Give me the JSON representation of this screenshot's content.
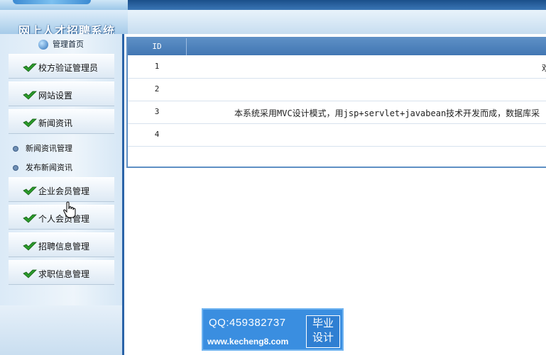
{
  "header": {
    "system_title": "网上人才招聘系统"
  },
  "sidebar": {
    "home_label": "管理首页",
    "menu": [
      {
        "label": "校方验证管理员"
      },
      {
        "label": "网站设置"
      },
      {
        "label": "新闻资讯"
      }
    ],
    "sub_items": [
      {
        "label": "新闻资讯管理"
      },
      {
        "label": "发布新闻资讯"
      }
    ],
    "menu2": [
      {
        "label": "企业会员管理"
      },
      {
        "label": "个人会员管理"
      },
      {
        "label": "招聘信息管理"
      },
      {
        "label": "求职信息管理"
      }
    ]
  },
  "table": {
    "header_id": "ID",
    "rows": [
      {
        "id": "1",
        "content": "欢"
      },
      {
        "id": "2",
        "content": ""
      },
      {
        "id": "3",
        "content": "本系统采用MVC设计模式，用jsp+servlet+javabean技术开发而成，数据库采"
      },
      {
        "id": "4",
        "content": ""
      }
    ]
  },
  "watermark": {
    "qq": "QQ:459382737",
    "url": "www.kecheng8.com",
    "badge_line1": "毕业",
    "badge_line2": "设计"
  },
  "colors": {
    "accent": "#2a63a8",
    "table_header": "#4f83bd",
    "banner": "#3a8ee0"
  }
}
